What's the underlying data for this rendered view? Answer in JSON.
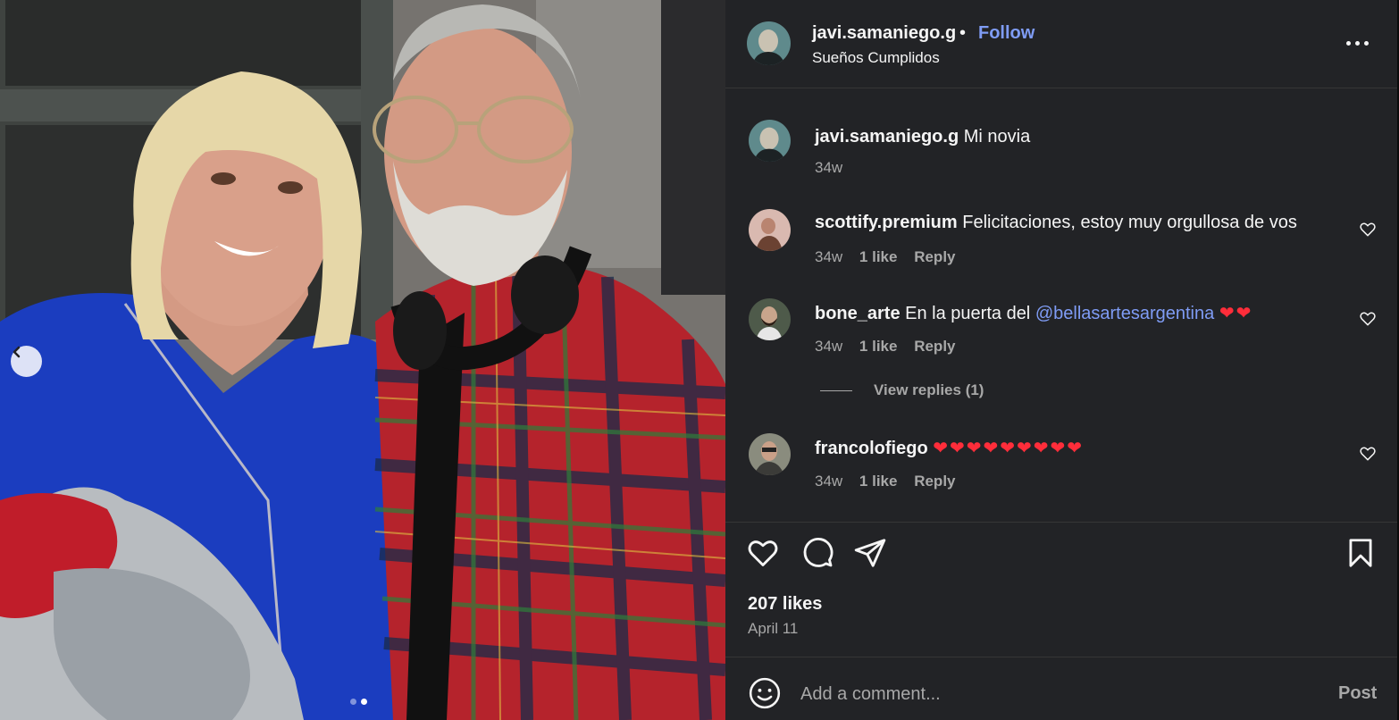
{
  "post": {
    "image_alt": "",
    "carousel": {
      "total": 2,
      "current": 2
    }
  },
  "header": {
    "username": "javi.samaniego.g",
    "separator": "•",
    "follow_label": "Follow",
    "subtitle": "Sueños Cumplidos"
  },
  "caption": {
    "username": "javi.samaniego.g",
    "text": "Mi novia",
    "time": "34w"
  },
  "comments": [
    {
      "username": "scottify.premium",
      "text": "Felicitaciones, estoy muy orgullosa de vos",
      "time": "34w",
      "likes": "1 like",
      "reply": "Reply"
    },
    {
      "username": "bone_arte",
      "text": "En la puerta del",
      "mention": "@bellasartesargentina",
      "hearts": "❤❤",
      "time": "34w",
      "likes": "1 like",
      "reply": "Reply",
      "view_replies": "View replies (1)"
    },
    {
      "username": "francolofiego",
      "hearts": "❤❤❤❤❤❤❤❤❤",
      "time": "34w",
      "likes": "1 like",
      "reply": "Reply"
    }
  ],
  "stats": {
    "likes": "207 likes",
    "date": "April 11"
  },
  "composer": {
    "placeholder": "Add a comment...",
    "post_label": "Post"
  },
  "colors": {
    "panel_bg": "#222326",
    "link": "#7f9cf5",
    "muted": "#a8a8a8",
    "heart": "#ff2d3a"
  },
  "icons": {
    "prev": "chevron-left-icon",
    "more": "more-options-icon",
    "like": "heart-icon",
    "comment": "comment-bubble-icon",
    "share": "share-paper-plane-icon",
    "save": "bookmark-icon",
    "emoji": "emoji-smile-icon"
  }
}
